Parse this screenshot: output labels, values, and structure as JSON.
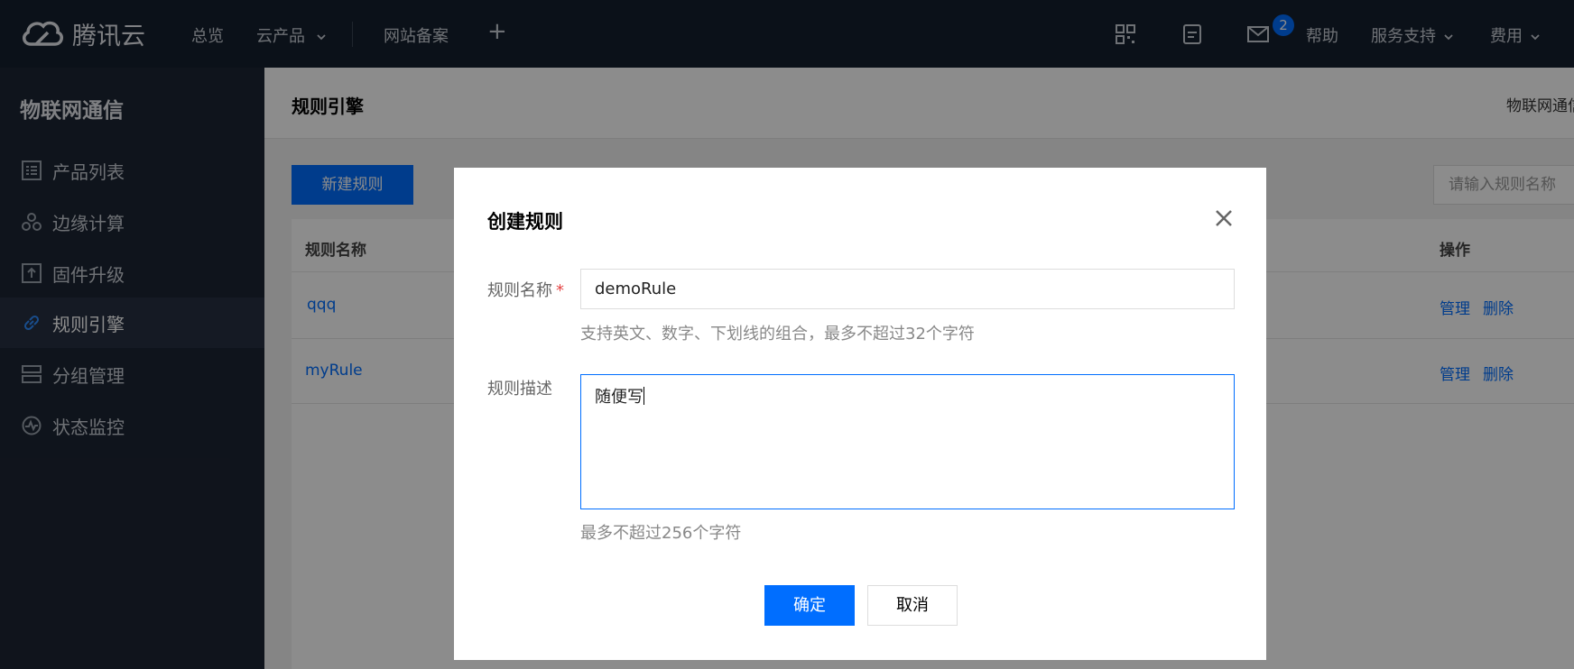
{
  "topbar": {
    "brand": "腾讯云",
    "nav": [
      "总览",
      "云产品",
      "网站备案"
    ],
    "plus": "+",
    "badge_count": "2",
    "right_items": [
      "帮助",
      "服务支持",
      "费用"
    ]
  },
  "sidebar": {
    "title": "物联网通信",
    "items": [
      {
        "label": "产品列表",
        "icon": "list-icon"
      },
      {
        "label": "边缘计算",
        "icon": "edge-icon"
      },
      {
        "label": "固件升级",
        "icon": "upload-icon"
      },
      {
        "label": "规则引擎",
        "icon": "link-icon"
      },
      {
        "label": "分组管理",
        "icon": "group-icon"
      },
      {
        "label": "状态监控",
        "icon": "monitor-icon"
      }
    ],
    "active_index": 3
  },
  "main": {
    "page_title": "规则引擎",
    "header_right": "物联网通信",
    "new_button": "新建规则",
    "search_placeholder": "请输入规则名称",
    "table": {
      "columns": [
        "规则名称",
        "操作"
      ],
      "rows": [
        {
          "name": "qqq",
          "actions": [
            "管理",
            "删除"
          ]
        },
        {
          "name": "myRule",
          "actions": [
            "管理",
            "删除"
          ]
        }
      ]
    }
  },
  "modal": {
    "title": "创建规则",
    "name_label": "规则名称",
    "required_mark": "*",
    "name_value": "demoRule",
    "name_hint": "支持英文、数字、下划线的组合，最多不超过32个字符",
    "desc_label": "规则描述",
    "desc_value": "随便写",
    "desc_hint": "最多不超过256个字符",
    "ok_label": "确定",
    "cancel_label": "取消"
  },
  "colors": {
    "accent": "#006eff",
    "topbar_bg": "#15202f",
    "sidebar_bg": "#1d2533"
  }
}
